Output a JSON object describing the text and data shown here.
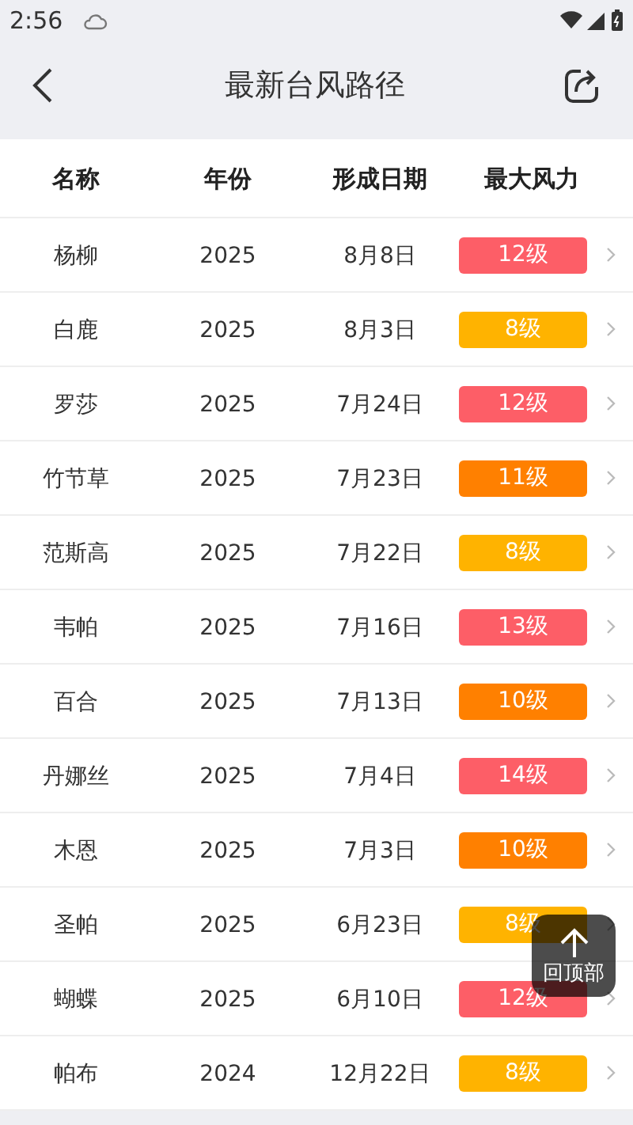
{
  "status_bar": {
    "time": "2:56"
  },
  "header": {
    "title": "最新台风路径"
  },
  "table": {
    "columns": [
      "名称",
      "年份",
      "形成日期",
      "最大风力"
    ],
    "rows": [
      {
        "name": "杨柳",
        "year": "2025",
        "date": "8月8日",
        "wind": "12级",
        "color": "#fd5e67"
      },
      {
        "name": "白鹿",
        "year": "2025",
        "date": "8月3日",
        "wind": "8级",
        "color": "#ffb300"
      },
      {
        "name": "罗莎",
        "year": "2025",
        "date": "7月24日",
        "wind": "12级",
        "color": "#fd5e67"
      },
      {
        "name": "竹节草",
        "year": "2025",
        "date": "7月23日",
        "wind": "11级",
        "color": "#ff8000"
      },
      {
        "name": "范斯高",
        "year": "2025",
        "date": "7月22日",
        "wind": "8级",
        "color": "#ffb300"
      },
      {
        "name": "韦帕",
        "year": "2025",
        "date": "7月16日",
        "wind": "13级",
        "color": "#fd5e67"
      },
      {
        "name": "百合",
        "year": "2025",
        "date": "7月13日",
        "wind": "10级",
        "color": "#ff8000"
      },
      {
        "name": "丹娜丝",
        "year": "2025",
        "date": "7月4日",
        "wind": "14级",
        "color": "#fd5e67"
      },
      {
        "name": "木恩",
        "year": "2025",
        "date": "7月3日",
        "wind": "10级",
        "color": "#ff8000"
      },
      {
        "name": "圣帕",
        "year": "2025",
        "date": "6月23日",
        "wind": "8级",
        "color": "#ffb300"
      },
      {
        "name": "蝴蝶",
        "year": "2025",
        "date": "6月10日",
        "wind": "12级",
        "color": "#fd5e67"
      },
      {
        "name": "帕布",
        "year": "2024",
        "date": "12月22日",
        "wind": "8级",
        "color": "#ffb300"
      }
    ]
  },
  "back_to_top": {
    "label": "回顶部"
  }
}
